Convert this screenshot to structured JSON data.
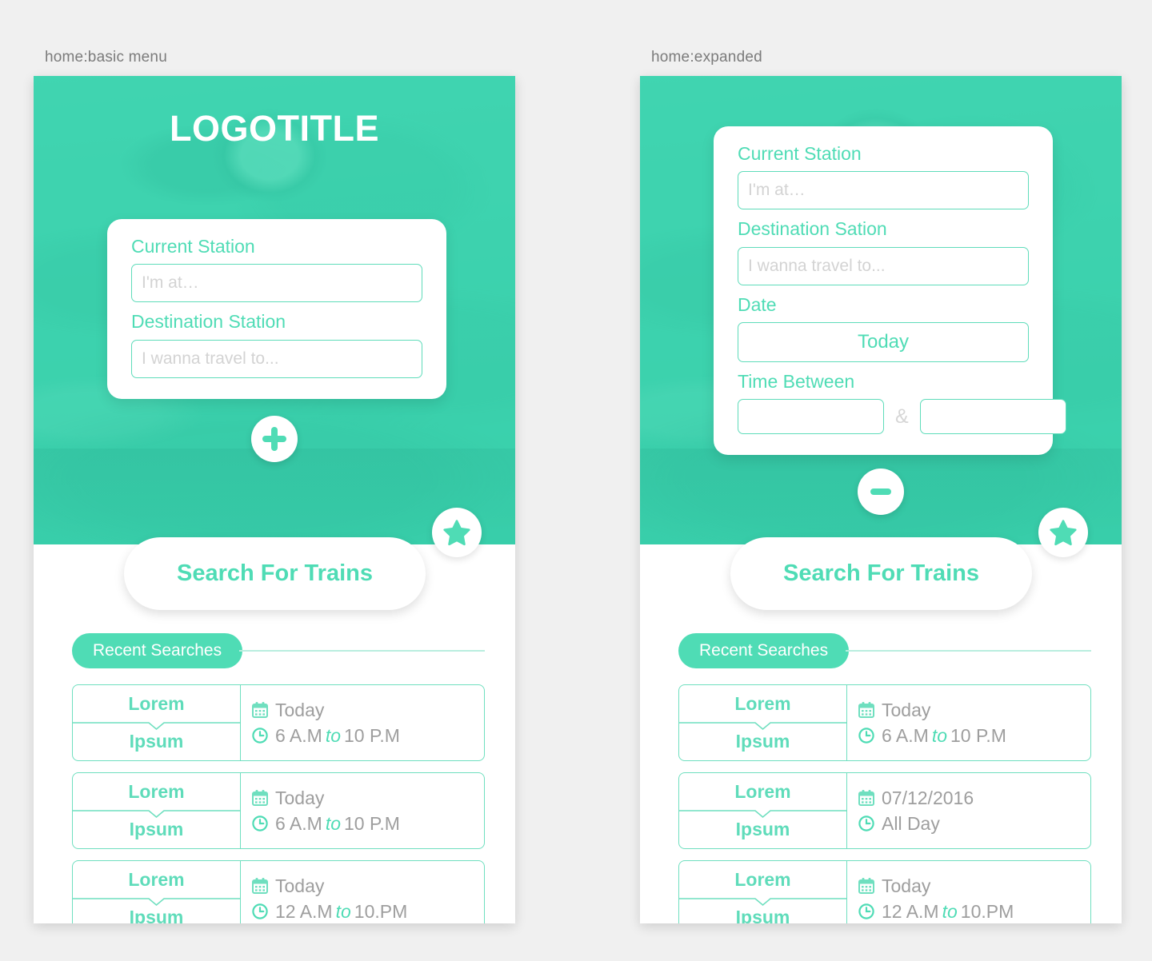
{
  "accent": "#4fdcb5",
  "hero_color": "#3ad3ae",
  "muted_text": "#9e9e9e",
  "screens": [
    {
      "label": "home:basic menu",
      "variant": "basic",
      "logo_title": "LOGOTITLE",
      "card": {
        "current_station_label": "Current Station",
        "current_station_placeholder": "I'm at…",
        "current_station_value": "",
        "destination_label": "Destination Station",
        "destination_placeholder": "I wanna travel to...",
        "destination_value": ""
      },
      "toggle": {
        "icon": "plus-icon",
        "glyph": "+"
      },
      "favorites_icon": "star-icon",
      "search_button": "Search For Trains",
      "recent": {
        "title": "Recent Searches",
        "rows": [
          {
            "origin": "Lorem",
            "destination": "Ipsum",
            "date_icon": "calendar-icon",
            "date": "Today",
            "time_icon": "clock-icon",
            "time_start": "6 A.M",
            "time_sep": "to",
            "time_end": "10 P.M"
          },
          {
            "origin": "Lorem",
            "destination": "Ipsum",
            "date_icon": "calendar-icon",
            "date": "Today",
            "time_icon": "clock-icon",
            "time_start": "6 A.M",
            "time_sep": "to",
            "time_end": "10 P.M"
          },
          {
            "origin": "Lorem",
            "destination": "Ipsum",
            "date_icon": "calendar-icon",
            "date": "Today",
            "time_icon": "clock-icon",
            "time_start": "12 A.M",
            "time_sep": "to",
            "time_end": " 10.PM"
          }
        ]
      }
    },
    {
      "label": "home:expanded",
      "variant": "expanded",
      "logo_title": "",
      "card": {
        "current_station_label": "Current Station",
        "current_station_placeholder": "I'm at…",
        "current_station_value": "",
        "destination_label": "Destination Sation",
        "destination_placeholder": "I wanna travel to...",
        "destination_value": "",
        "date_label": "Date",
        "date_value": "Today",
        "time_label": "Time Between",
        "time_from_value": "",
        "time_to_value": "",
        "time_separator": "&"
      },
      "toggle": {
        "icon": "minus-icon",
        "glyph": "−"
      },
      "favorites_icon": "star-icon",
      "search_button": "Search For Trains",
      "recent": {
        "title": "Recent Searches",
        "rows": [
          {
            "origin": "Lorem",
            "destination": "Ipsum",
            "date_icon": "calendar-icon",
            "date": "Today",
            "time_icon": "clock-icon",
            "time_start": "6 A.M",
            "time_sep": "to",
            "time_end": "10 P.M"
          },
          {
            "origin": "Lorem",
            "destination": "Ipsum",
            "date_icon": "calendar-icon",
            "date": "07/12/2016",
            "time_icon": "clock-icon",
            "time_start": "All Day",
            "time_sep": "",
            "time_end": ""
          },
          {
            "origin": "Lorem",
            "destination": "Ipsum",
            "date_icon": "calendar-icon",
            "date": "Today",
            "time_icon": "clock-icon",
            "time_start": "12 A.M",
            "time_sep": "to",
            "time_end": " 10.PM"
          }
        ]
      }
    }
  ]
}
